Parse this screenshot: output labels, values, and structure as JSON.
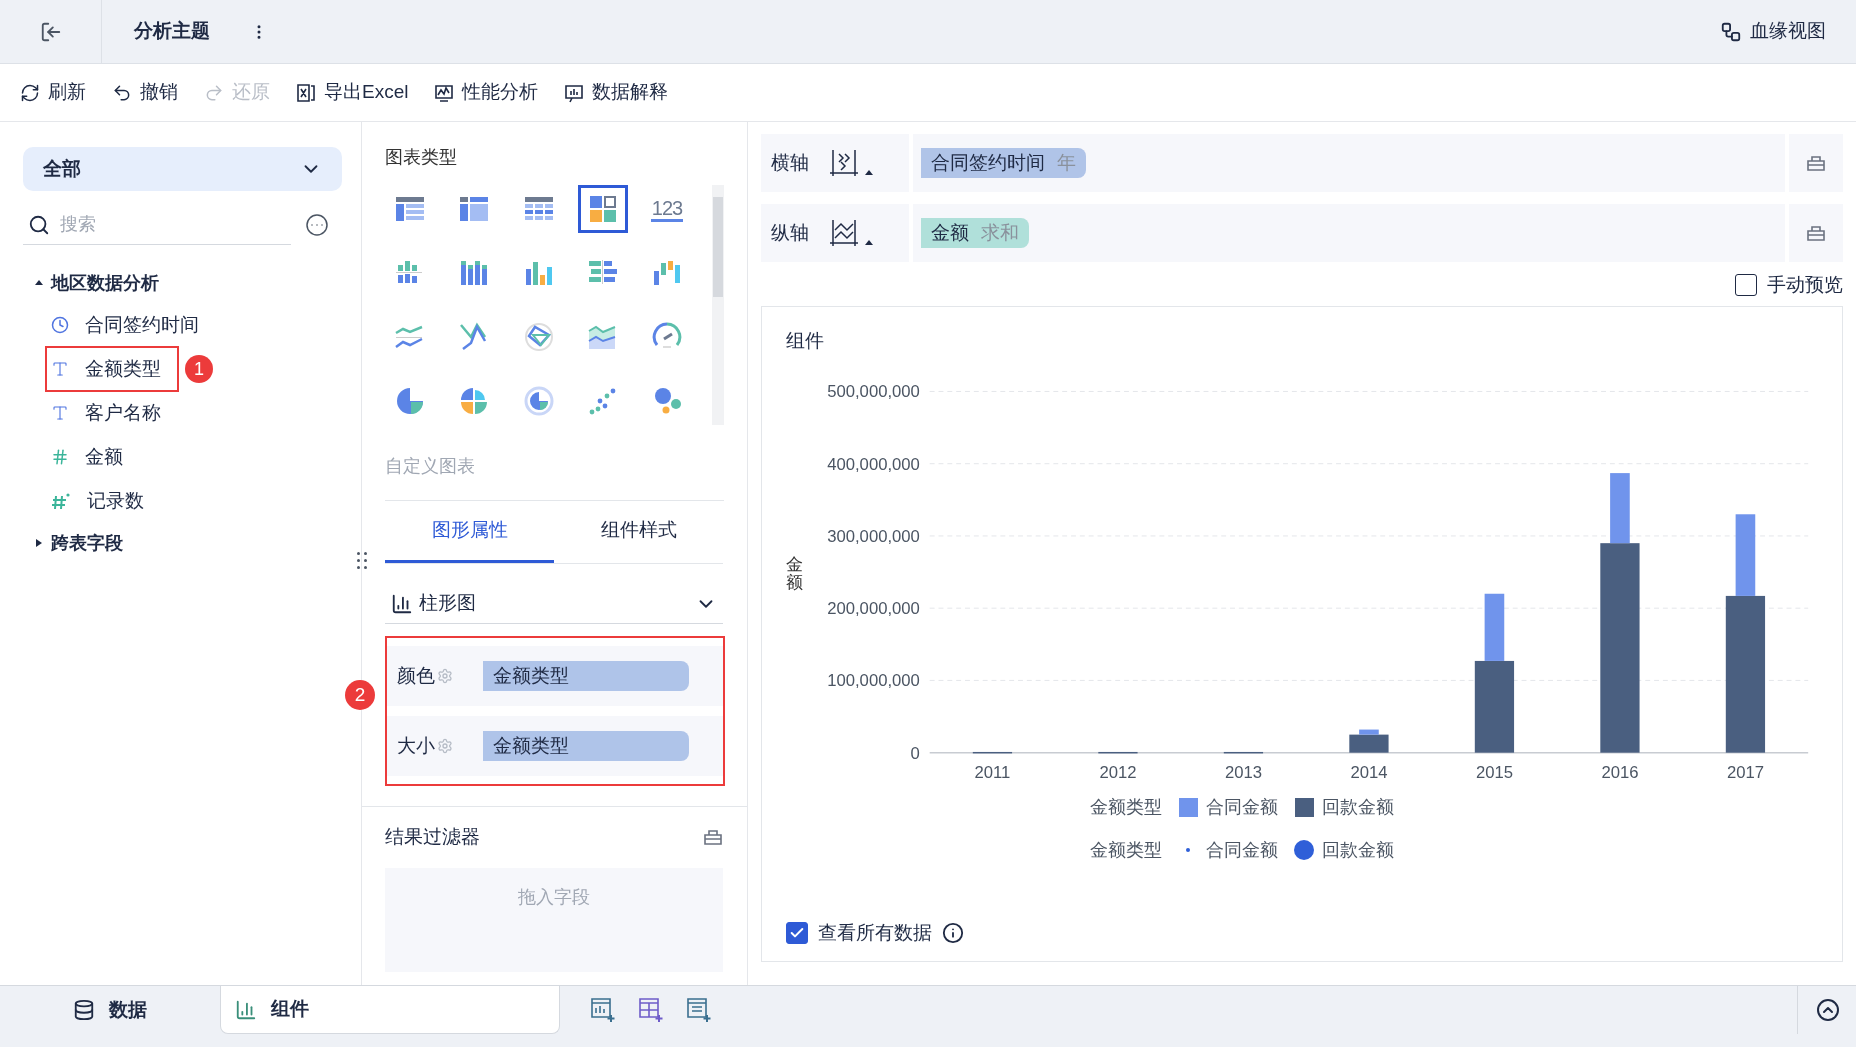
{
  "header": {
    "title": "分析主题",
    "lineage": "血缘视图"
  },
  "toolbar": [
    {
      "kind": "refresh",
      "label": "刷新",
      "disabled": false
    },
    {
      "kind": "undo",
      "label": "撤销",
      "disabled": false
    },
    {
      "kind": "redo",
      "label": "还原",
      "disabled": true
    },
    {
      "kind": "excel",
      "label": "导出Excel",
      "disabled": false
    },
    {
      "kind": "perf",
      "label": "性能分析",
      "disabled": false
    },
    {
      "kind": "explain",
      "label": "数据解释",
      "disabled": false
    }
  ],
  "fields_panel": {
    "scope": "全部",
    "search_placeholder": "搜索",
    "groups": [
      {
        "label": "地区数据分析",
        "expanded": true,
        "children": [
          {
            "kind": "time",
            "label": "合同签约时间"
          },
          {
            "kind": "text",
            "label": "金额类型",
            "annotation": "1"
          },
          {
            "kind": "text",
            "label": "客户名称"
          },
          {
            "kind": "number",
            "label": "金额"
          },
          {
            "kind": "count",
            "label": "记录数"
          }
        ]
      },
      {
        "label": "跨表字段",
        "expanded": false
      }
    ]
  },
  "chart_types": {
    "title": "图表类型",
    "items": [
      {
        "kind": "table",
        "selected": false
      },
      {
        "kind": "crosstable",
        "selected": false
      },
      {
        "kind": "detail",
        "selected": false
      },
      {
        "kind": "dashboard",
        "selected": true
      },
      {
        "kind": "kpi",
        "label": "123",
        "selected": false
      },
      {
        "kind": "grouped-bar",
        "selected": false
      },
      {
        "kind": "multi-bar",
        "selected": false
      },
      {
        "kind": "bar",
        "selected": false
      },
      {
        "kind": "hbar",
        "selected": false
      },
      {
        "kind": "waterfall",
        "selected": false
      },
      {
        "kind": "line",
        "selected": false
      },
      {
        "kind": "cross-line",
        "selected": false
      },
      {
        "kind": "radar",
        "selected": false
      },
      {
        "kind": "area",
        "selected": false
      },
      {
        "kind": "gauge",
        "selected": false
      },
      {
        "kind": "pie",
        "selected": false
      },
      {
        "kind": "rose",
        "selected": false
      },
      {
        "kind": "ring",
        "selected": false
      },
      {
        "kind": "scatter",
        "selected": false
      },
      {
        "kind": "bubble",
        "selected": false
      }
    ],
    "custom": "自定义图表"
  },
  "property_tabs": [
    {
      "label": "图形属性",
      "selected": true
    },
    {
      "label": "组件样式",
      "selected": false
    }
  ],
  "properties": {
    "chart": "柱形图",
    "annotation": "2",
    "rows": [
      {
        "label": "颜色",
        "field": "金额类型"
      },
      {
        "label": "大小",
        "field": "金额类型"
      }
    ]
  },
  "result_filter": {
    "title": "结果过滤器",
    "placeholder": "拖入字段"
  },
  "axes": [
    {
      "kind": "x",
      "label": "横轴",
      "field": "合同签约时间",
      "aggregate": "年",
      "color": "#b0c4e8"
    },
    {
      "kind": "y",
      "label": "纵轴",
      "field": "金额",
      "aggregate": "求和",
      "color": "#b0e0da"
    }
  ],
  "manual_preview": {
    "label": "手动预览",
    "checked": false
  },
  "component": {
    "title": "组件",
    "chart_data": {
      "type": "bar",
      "ylabel": "金额",
      "stacked": true,
      "grid": true,
      "categories": [
        "2011",
        "2012",
        "2013",
        "2014",
        "2015",
        "2016",
        "2017"
      ],
      "series": [
        {
          "name": "回款金额",
          "color": "#4a5f80",
          "values": [
            1000000,
            1000000,
            1000000,
            25000000,
            127000000,
            290000000,
            217000000
          ]
        },
        {
          "name": "合同金额",
          "color": "#7094ec",
          "values": [
            0,
            0,
            0,
            7000000,
            93000000,
            97000000,
            113000000
          ]
        }
      ],
      "ylim": [
        0,
        500000000
      ],
      "yticks": [
        {
          "value": 0,
          "label": "0"
        },
        {
          "value": 100000000,
          "label": "100,000,000"
        },
        {
          "value": 200000000,
          "label": "200,000,000"
        },
        {
          "value": 300000000,
          "label": "300,000,000"
        },
        {
          "value": 400000000,
          "label": "400,000,000"
        },
        {
          "value": 500000000,
          "label": "500,000,000"
        }
      ]
    },
    "legends": [
      {
        "kind": "color",
        "title": "金额类型"
      },
      {
        "kind": "size",
        "title": "金额类型",
        "items": [
          {
            "label": "合同金额",
            "color": "#2f5fd8",
            "kind": "small"
          },
          {
            "label": "回款金额",
            "color": "#2f5fd8",
            "kind": "large"
          }
        ]
      }
    ],
    "show_all": {
      "label": "查看所有数据",
      "checked": true
    }
  },
  "bottom_tabs": [
    {
      "kind": "data",
      "label": "数据",
      "selected": false
    },
    {
      "kind": "component",
      "label": "组件",
      "selected": true
    }
  ]
}
